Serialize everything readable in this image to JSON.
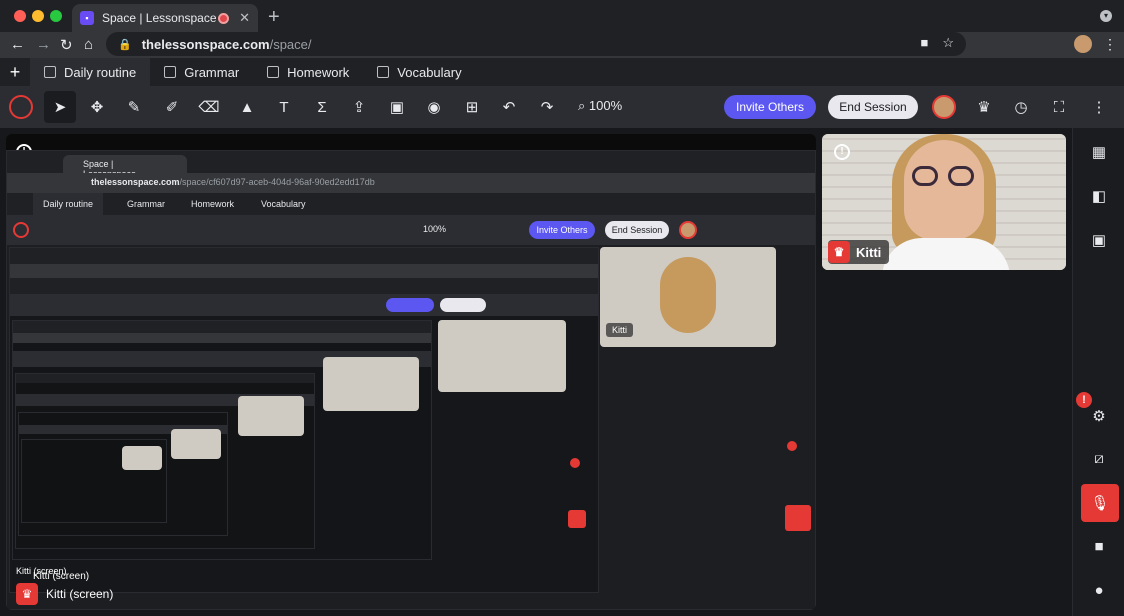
{
  "browser": {
    "tab_title": "Space | Lessonspace",
    "tab_close": "✕",
    "new_tab": "+",
    "url_host": "thelessonspace.com",
    "url_path": "/space/",
    "back_icon": "←",
    "forward_icon": "→",
    "reload_icon": "↻",
    "home_icon": "⌂",
    "lock_icon": "🔒",
    "camera_icon": "■",
    "star_icon": "☆",
    "kebab": "⋮"
  },
  "app_tabs": {
    "add_label": "+",
    "items": [
      {
        "label": "Daily routine",
        "active": true
      },
      {
        "label": "Grammar",
        "active": false
      },
      {
        "label": "Homework",
        "active": false
      },
      {
        "label": "Vocabulary",
        "active": false
      }
    ]
  },
  "toolbar": {
    "tools": [
      {
        "name": "select",
        "glyph": "➤"
      },
      {
        "name": "move",
        "glyph": "✥"
      },
      {
        "name": "pen",
        "glyph": "✎"
      },
      {
        "name": "highlighter",
        "glyph": "✐"
      },
      {
        "name": "eraser",
        "glyph": "⌫"
      },
      {
        "name": "shapes",
        "glyph": "▲"
      },
      {
        "name": "text",
        "glyph": "T"
      },
      {
        "name": "math",
        "glyph": "Σ"
      },
      {
        "name": "upload",
        "glyph": "⇪"
      },
      {
        "name": "image",
        "glyph": "▣"
      },
      {
        "name": "camera",
        "glyph": "◉"
      },
      {
        "name": "table",
        "glyph": "⊞"
      },
      {
        "name": "undo",
        "glyph": "↶"
      },
      {
        "name": "redo",
        "glyph": "↷"
      }
    ],
    "zoom_icon": "⌕",
    "zoom_value": "100%",
    "invite_label": "Invite Others",
    "end_session_label": "End Session",
    "crown_icon": "♛",
    "timer_icon": "◷",
    "fullscreen_icon": "⛶",
    "more_icon": "⋮"
  },
  "screen_share": {
    "alert_glyph": "!",
    "label": "Kitti (screen)",
    "crown": "♛",
    "nested": {
      "url_host": "thelessonspace.com",
      "url_path": "/space/cf607d97-aceb-404d-96af-90ed2edd17db",
      "tabs": [
        "Daily routine",
        "Grammar",
        "Homework",
        "Vocabulary"
      ],
      "invite": "Invite Others",
      "end": "End Session",
      "zoom": "100%",
      "tab_title": "Space | Lessonspace",
      "video_name": "Kitti",
      "screen_labels": [
        "Kitti (screen)",
        "Kitti (screen)"
      ]
    }
  },
  "video": {
    "alert_glyph": "!",
    "name": "Kitti",
    "crown": "♛"
  },
  "sidebar": {
    "layout_icons": [
      "▦",
      "◧",
      "▣"
    ],
    "alert_glyph": "!",
    "settings_icon": "⚙",
    "screen_share_icon": "⧄",
    "mic_icon": "🎙",
    "camera_icon": "■",
    "chat_icon": "●"
  },
  "colors": {
    "accent": "#5b57f0",
    "danger": "#e53935",
    "background": "#17181b"
  }
}
